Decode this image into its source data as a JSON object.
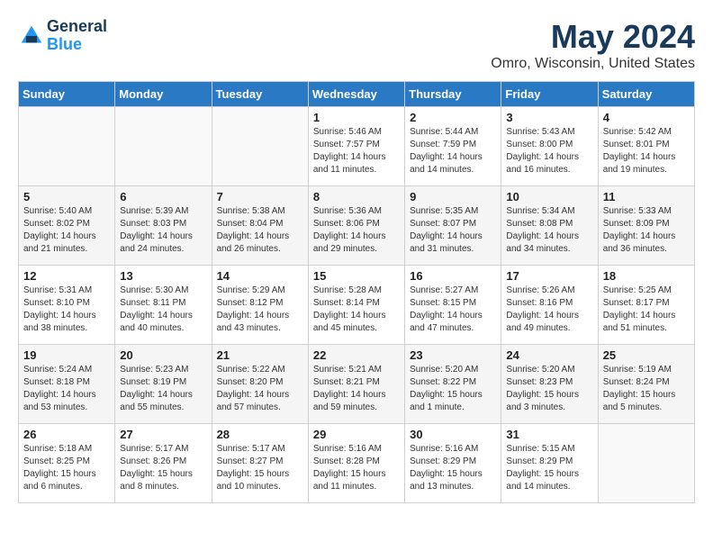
{
  "header": {
    "logo_line1": "General",
    "logo_line2": "Blue",
    "main_title": "May 2024",
    "subtitle": "Omro, Wisconsin, United States"
  },
  "calendar": {
    "headers": [
      "Sunday",
      "Monday",
      "Tuesday",
      "Wednesday",
      "Thursday",
      "Friday",
      "Saturday"
    ],
    "weeks": [
      [
        {
          "day": "",
          "sunrise": "",
          "sunset": "",
          "daylight": ""
        },
        {
          "day": "",
          "sunrise": "",
          "sunset": "",
          "daylight": ""
        },
        {
          "day": "",
          "sunrise": "",
          "sunset": "",
          "daylight": ""
        },
        {
          "day": "1",
          "sunrise": "Sunrise: 5:46 AM",
          "sunset": "Sunset: 7:57 PM",
          "daylight": "Daylight: 14 hours and 11 minutes."
        },
        {
          "day": "2",
          "sunrise": "Sunrise: 5:44 AM",
          "sunset": "Sunset: 7:59 PM",
          "daylight": "Daylight: 14 hours and 14 minutes."
        },
        {
          "day": "3",
          "sunrise": "Sunrise: 5:43 AM",
          "sunset": "Sunset: 8:00 PM",
          "daylight": "Daylight: 14 hours and 16 minutes."
        },
        {
          "day": "4",
          "sunrise": "Sunrise: 5:42 AM",
          "sunset": "Sunset: 8:01 PM",
          "daylight": "Daylight: 14 hours and 19 minutes."
        }
      ],
      [
        {
          "day": "5",
          "sunrise": "Sunrise: 5:40 AM",
          "sunset": "Sunset: 8:02 PM",
          "daylight": "Daylight: 14 hours and 21 minutes."
        },
        {
          "day": "6",
          "sunrise": "Sunrise: 5:39 AM",
          "sunset": "Sunset: 8:03 PM",
          "daylight": "Daylight: 14 hours and 24 minutes."
        },
        {
          "day": "7",
          "sunrise": "Sunrise: 5:38 AM",
          "sunset": "Sunset: 8:04 PM",
          "daylight": "Daylight: 14 hours and 26 minutes."
        },
        {
          "day": "8",
          "sunrise": "Sunrise: 5:36 AM",
          "sunset": "Sunset: 8:06 PM",
          "daylight": "Daylight: 14 hours and 29 minutes."
        },
        {
          "day": "9",
          "sunrise": "Sunrise: 5:35 AM",
          "sunset": "Sunset: 8:07 PM",
          "daylight": "Daylight: 14 hours and 31 minutes."
        },
        {
          "day": "10",
          "sunrise": "Sunrise: 5:34 AM",
          "sunset": "Sunset: 8:08 PM",
          "daylight": "Daylight: 14 hours and 34 minutes."
        },
        {
          "day": "11",
          "sunrise": "Sunrise: 5:33 AM",
          "sunset": "Sunset: 8:09 PM",
          "daylight": "Daylight: 14 hours and 36 minutes."
        }
      ],
      [
        {
          "day": "12",
          "sunrise": "Sunrise: 5:31 AM",
          "sunset": "Sunset: 8:10 PM",
          "daylight": "Daylight: 14 hours and 38 minutes."
        },
        {
          "day": "13",
          "sunrise": "Sunrise: 5:30 AM",
          "sunset": "Sunset: 8:11 PM",
          "daylight": "Daylight: 14 hours and 40 minutes."
        },
        {
          "day": "14",
          "sunrise": "Sunrise: 5:29 AM",
          "sunset": "Sunset: 8:12 PM",
          "daylight": "Daylight: 14 hours and 43 minutes."
        },
        {
          "day": "15",
          "sunrise": "Sunrise: 5:28 AM",
          "sunset": "Sunset: 8:14 PM",
          "daylight": "Daylight: 14 hours and 45 minutes."
        },
        {
          "day": "16",
          "sunrise": "Sunrise: 5:27 AM",
          "sunset": "Sunset: 8:15 PM",
          "daylight": "Daylight: 14 hours and 47 minutes."
        },
        {
          "day": "17",
          "sunrise": "Sunrise: 5:26 AM",
          "sunset": "Sunset: 8:16 PM",
          "daylight": "Daylight: 14 hours and 49 minutes."
        },
        {
          "day": "18",
          "sunrise": "Sunrise: 5:25 AM",
          "sunset": "Sunset: 8:17 PM",
          "daylight": "Daylight: 14 hours and 51 minutes."
        }
      ],
      [
        {
          "day": "19",
          "sunrise": "Sunrise: 5:24 AM",
          "sunset": "Sunset: 8:18 PM",
          "daylight": "Daylight: 14 hours and 53 minutes."
        },
        {
          "day": "20",
          "sunrise": "Sunrise: 5:23 AM",
          "sunset": "Sunset: 8:19 PM",
          "daylight": "Daylight: 14 hours and 55 minutes."
        },
        {
          "day": "21",
          "sunrise": "Sunrise: 5:22 AM",
          "sunset": "Sunset: 8:20 PM",
          "daylight": "Daylight: 14 hours and 57 minutes."
        },
        {
          "day": "22",
          "sunrise": "Sunrise: 5:21 AM",
          "sunset": "Sunset: 8:21 PM",
          "daylight": "Daylight: 14 hours and 59 minutes."
        },
        {
          "day": "23",
          "sunrise": "Sunrise: 5:20 AM",
          "sunset": "Sunset: 8:22 PM",
          "daylight": "Daylight: 15 hours and 1 minute."
        },
        {
          "day": "24",
          "sunrise": "Sunrise: 5:20 AM",
          "sunset": "Sunset: 8:23 PM",
          "daylight": "Daylight: 15 hours and 3 minutes."
        },
        {
          "day": "25",
          "sunrise": "Sunrise: 5:19 AM",
          "sunset": "Sunset: 8:24 PM",
          "daylight": "Daylight: 15 hours and 5 minutes."
        }
      ],
      [
        {
          "day": "26",
          "sunrise": "Sunrise: 5:18 AM",
          "sunset": "Sunset: 8:25 PM",
          "daylight": "Daylight: 15 hours and 6 minutes."
        },
        {
          "day": "27",
          "sunrise": "Sunrise: 5:17 AM",
          "sunset": "Sunset: 8:26 PM",
          "daylight": "Daylight: 15 hours and 8 minutes."
        },
        {
          "day": "28",
          "sunrise": "Sunrise: 5:17 AM",
          "sunset": "Sunset: 8:27 PM",
          "daylight": "Daylight: 15 hours and 10 minutes."
        },
        {
          "day": "29",
          "sunrise": "Sunrise: 5:16 AM",
          "sunset": "Sunset: 8:28 PM",
          "daylight": "Daylight: 15 hours and 11 minutes."
        },
        {
          "day": "30",
          "sunrise": "Sunrise: 5:16 AM",
          "sunset": "Sunset: 8:29 PM",
          "daylight": "Daylight: 15 hours and 13 minutes."
        },
        {
          "day": "31",
          "sunrise": "Sunrise: 5:15 AM",
          "sunset": "Sunset: 8:29 PM",
          "daylight": "Daylight: 15 hours and 14 minutes."
        },
        {
          "day": "",
          "sunrise": "",
          "sunset": "",
          "daylight": ""
        }
      ]
    ]
  }
}
